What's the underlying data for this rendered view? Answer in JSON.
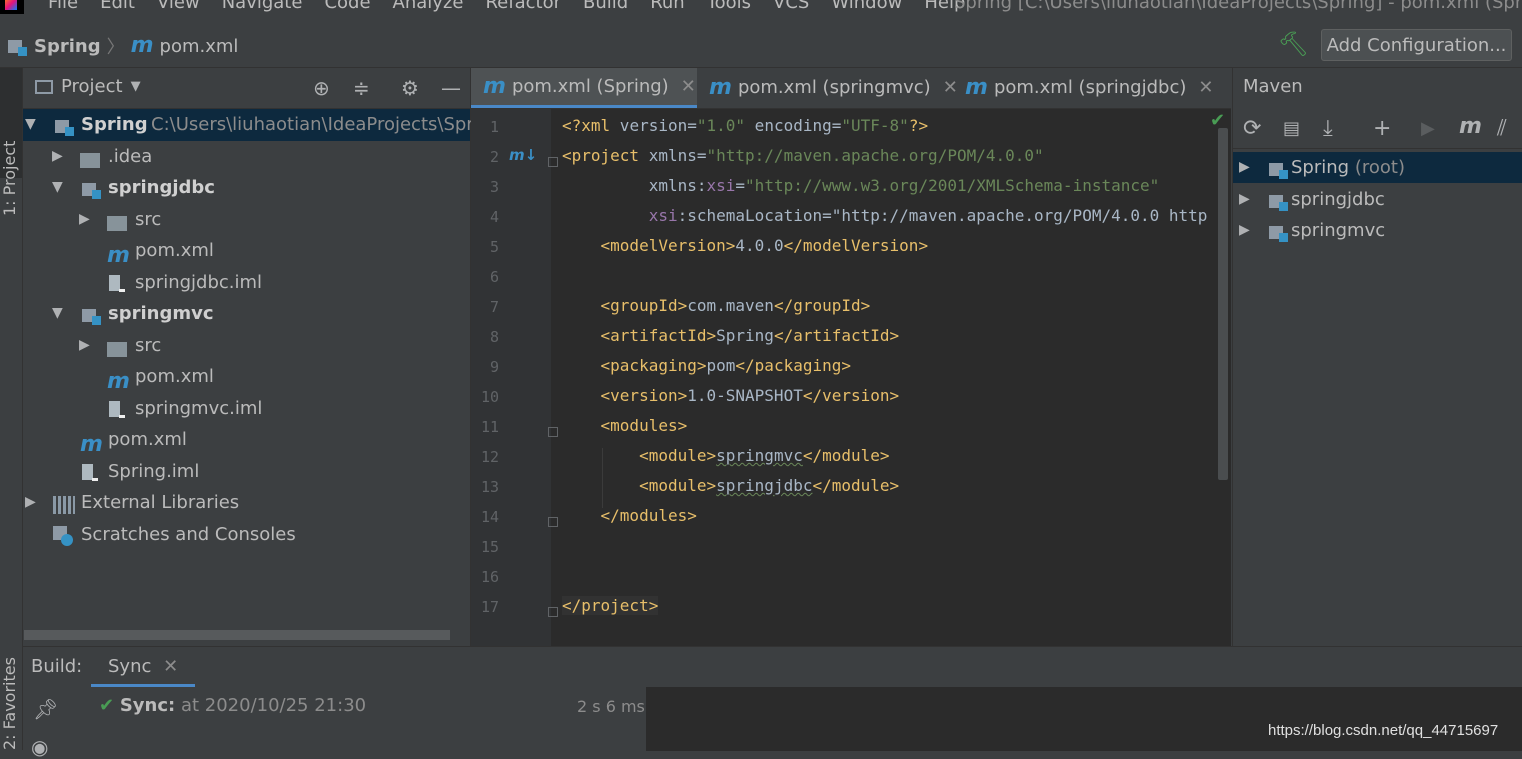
{
  "menu": {
    "items": [
      "File",
      "Edit",
      "View",
      "Navigate",
      "Code",
      "Analyze",
      "Refactor",
      "Build",
      "Run",
      "Tools",
      "VCS",
      "Window",
      "Help"
    ],
    "window_title": "Spring [C:\\Users\\liuhaotian\\IdeaProjects\\Spring] - pom.xml (Spring)"
  },
  "navbar": {
    "project": "Spring",
    "file": "pom.xml",
    "add_configuration": "Add Configuration..."
  },
  "stripes": {
    "project": "1: Project",
    "favorites": "2: Favorites"
  },
  "project_panel": {
    "title": "Project",
    "tree": [
      {
        "label": "Spring",
        "path": "C:\\Users\\liuhaotian\\IdeaProjects\\Spring",
        "type": "module",
        "level": 0,
        "expanded": true,
        "selected": true
      },
      {
        "label": ".idea",
        "type": "folder",
        "level": 1,
        "expanded": false
      },
      {
        "label": "springjdbc",
        "type": "module",
        "level": 1,
        "expanded": true
      },
      {
        "label": "src",
        "type": "folder",
        "level": 2,
        "expanded": false
      },
      {
        "label": "pom.xml",
        "type": "maven",
        "level": 2
      },
      {
        "label": "springjdbc.iml",
        "type": "iml",
        "level": 2
      },
      {
        "label": "springmvc",
        "type": "module",
        "level": 1,
        "expanded": true
      },
      {
        "label": "src",
        "type": "folder",
        "level": 2,
        "expanded": false
      },
      {
        "label": "pom.xml",
        "type": "maven",
        "level": 2
      },
      {
        "label": "springmvc.iml",
        "type": "iml",
        "level": 2
      },
      {
        "label": "pom.xml",
        "type": "maven",
        "level": 1
      },
      {
        "label": "Spring.iml",
        "type": "iml",
        "level": 1
      },
      {
        "label": "External Libraries",
        "type": "libs",
        "level": 0,
        "expanded": false
      },
      {
        "label": "Scratches and Consoles",
        "type": "scratch",
        "level": 0
      }
    ]
  },
  "editor": {
    "tabs": [
      {
        "label": "pom.xml (Spring)",
        "active": true
      },
      {
        "label": "pom.xml (springmvc)",
        "active": false
      },
      {
        "label": "pom.xml (springjdbc)",
        "active": false
      }
    ],
    "line_numbers": [
      "1",
      "2",
      "3",
      "4",
      "5",
      "6",
      "7",
      "8",
      "9",
      "10",
      "11",
      "12",
      "13",
      "14",
      "15",
      "16",
      "17"
    ],
    "lines": [
      {
        "n": 1,
        "text": "<?xml version=\"1.0\" encoding=\"UTF-8\"?>"
      },
      {
        "n": 2,
        "text": "<project xmlns=\"http://maven.apache.org/POM/4.0.0\""
      },
      {
        "n": 3,
        "text": "         xmlns:xsi=\"http://www.w3.org/2001/XMLSchema-instance\""
      },
      {
        "n": 4,
        "text": "         xsi:schemaLocation=\"http://maven.apache.org/POM/4.0.0 http"
      },
      {
        "n": 5,
        "text": "    <modelVersion>4.0.0</modelVersion>"
      },
      {
        "n": 6,
        "text": ""
      },
      {
        "n": 7,
        "text": "    <groupId>com.maven</groupId>"
      },
      {
        "n": 8,
        "text": "    <artifactId>Spring</artifactId>"
      },
      {
        "n": 9,
        "text": "    <packaging>pom</packaging>"
      },
      {
        "n": 10,
        "text": "    <version>1.0-SNAPSHOT</version>"
      },
      {
        "n": 11,
        "text": "    <modules>"
      },
      {
        "n": 12,
        "text": "        <module>springmvc</module>"
      },
      {
        "n": 13,
        "text": "        <module>springjdbc</module>"
      },
      {
        "n": 14,
        "text": "    </modules>"
      },
      {
        "n": 15,
        "text": ""
      },
      {
        "n": 16,
        "text": ""
      },
      {
        "n": 17,
        "text": "</project>"
      }
    ]
  },
  "maven": {
    "title": "Maven",
    "projects": [
      {
        "label": "Spring",
        "suffix": "(root)",
        "selected": true
      },
      {
        "label": "springjdbc",
        "suffix": "",
        "selected": false
      },
      {
        "label": "springmvc",
        "suffix": "",
        "selected": false
      }
    ]
  },
  "build": {
    "label": "Build:",
    "tab": "Sync",
    "sync_label": "Sync:",
    "sync_detail": "at 2020/10/25 21:30",
    "duration": "2 s 6 ms"
  },
  "watermark": "https://blog.csdn.net/qq_44715697",
  "colors": {
    "background": "#3c3f41",
    "editor_bg": "#2b2b2b",
    "selection": "#0d293e",
    "xml_tag": "#e8bf6a",
    "xml_string": "#6a8759",
    "namespace": "#9876aa",
    "maven_blue": "#3a8fc6",
    "success_green": "#499c54"
  }
}
